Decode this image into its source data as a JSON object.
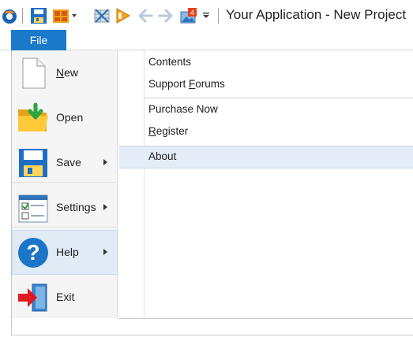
{
  "window": {
    "title": "Your Application - New Project",
    "qa_badge": "4"
  },
  "ribbon": {
    "file_tab": "File"
  },
  "backstage": {
    "nav": [
      {
        "label_pre": "",
        "label_u": "N",
        "label_post": "ew",
        "has_arrow": false
      },
      {
        "label": "Open",
        "has_arrow": false
      },
      {
        "label": "Save",
        "has_arrow": true
      },
      {
        "label": "Settings",
        "has_arrow": true
      },
      {
        "label": "Help",
        "has_arrow": true,
        "selected": true
      },
      {
        "label": "Exit",
        "has_arrow": false
      }
    ],
    "help_menu": {
      "contents": "Contents",
      "support_pre": "Support ",
      "support_u": "F",
      "support_post": "orums",
      "purchase": "Purchase Now",
      "register_u": "R",
      "register_post": "egister",
      "about": "About"
    }
  },
  "colors": {
    "accent": "#1979ca",
    "selected_bg": "#e1ebf6",
    "about_bg": "#e4ecf7",
    "exit_arrow": "#e0191f",
    "open_arrow": "#2aa63c",
    "help_circle": "#1b76c8"
  }
}
